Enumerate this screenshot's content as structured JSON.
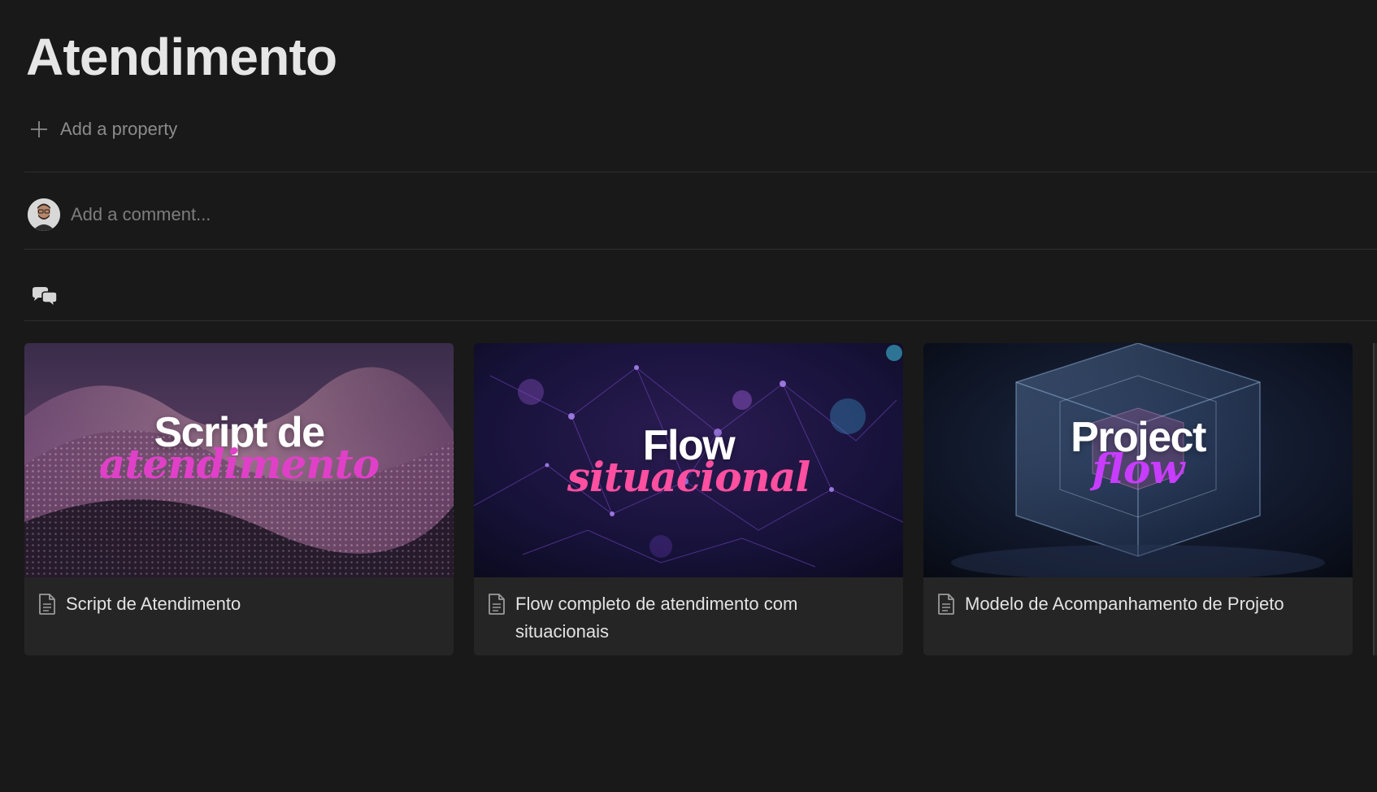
{
  "page": {
    "title": "Atendimento"
  },
  "property": {
    "add_label": "Add a property",
    "icon": "plus-icon"
  },
  "comment": {
    "placeholder": "Add a comment...",
    "avatar": "user-avatar"
  },
  "discussion": {
    "icon": "chat-bubbles-icon"
  },
  "gallery": {
    "cards": [
      {
        "title": "Script de Atendimento",
        "cover_main": "Script de",
        "cover_script": "atendimento",
        "icon": "document-icon"
      },
      {
        "title": "Flow completo de atendimento com situacionais",
        "cover_main": "Flow",
        "cover_script": "situacional",
        "icon": "document-icon"
      },
      {
        "title": "Modelo de Acompanhamento de Projeto",
        "cover_main": "Project",
        "cover_script": "flow",
        "icon": "document-icon"
      }
    ]
  },
  "colors": {
    "background": "#191919",
    "card": "#252525",
    "text": "#e3e3e3",
    "muted": "#8b8b8b",
    "accent_pink": "#ff4fa0",
    "accent_purple": "#c83cff"
  }
}
